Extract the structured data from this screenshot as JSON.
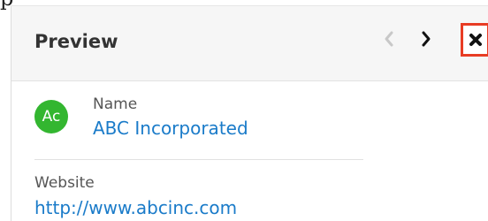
{
  "top_strip": {
    "text": "p"
  },
  "panel": {
    "title": "Preview",
    "navigation": {
      "previous_icon": "chevron-left-icon",
      "next_icon": "chevron-right-icon",
      "close_icon": "close-icon"
    },
    "record": {
      "avatar_initials": "Ac",
      "name_label": "Name",
      "name_value": "ABC Incorporated",
      "website_label": "Website",
      "website_value": "http://www.abcinc.com"
    },
    "colors": {
      "header_background": "#f6f6f6",
      "avatar_background": "#33b630",
      "link": "#1a7bc9",
      "close_highlight": "#e83c24",
      "muted_text": "#555555"
    }
  }
}
